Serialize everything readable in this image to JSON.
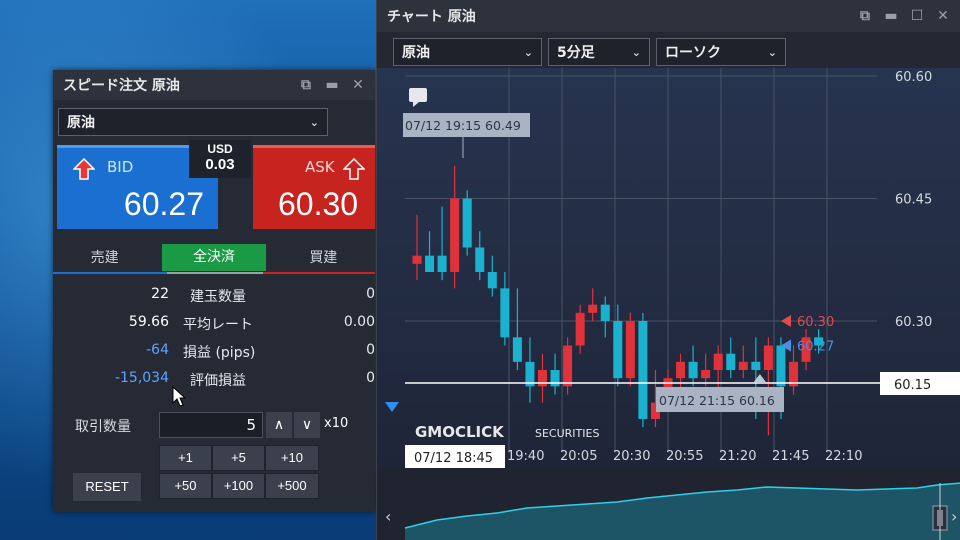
{
  "order_window": {
    "title": "スピード注文 原油",
    "symbol_select": "原油",
    "bid": {
      "label": "BID",
      "price": "60.27"
    },
    "ask": {
      "label": "ASK",
      "price": "60.30"
    },
    "spread": {
      "currency": "USD",
      "value": "0.03"
    },
    "tabs": [
      "売建",
      "全決済",
      "買建"
    ],
    "positions": [
      {
        "value": "22",
        "key": "建玉数量",
        "right": "0"
      },
      {
        "value": "59.66",
        "key": "平均レート",
        "right": "0.00"
      },
      {
        "value": "-64",
        "key": "損益 (pips)",
        "right": "0"
      },
      {
        "value": "-15,034",
        "key": "評価損益",
        "right": "0"
      }
    ],
    "lot": {
      "label": "取引数量",
      "value": "5",
      "multiplier": "x10"
    },
    "quick_buttons": [
      "+1",
      "+5",
      "+10",
      "+50",
      "+100",
      "+500"
    ],
    "reset_label": "RESET"
  },
  "chart_window": {
    "title": "チャート 原油",
    "symbol_select": "原油",
    "timeframe_select": "5分足",
    "type_select": "ローソク",
    "price_labels": [
      "60.60",
      "60.45",
      "60.30",
      "60.15"
    ],
    "time_labels": [
      "19:40",
      "20:05",
      "20:30",
      "20:55",
      "21:20",
      "21:45",
      "22:10"
    ],
    "high_marker": "07/12 19:15 60.49",
    "low_marker": "07/12 21:15 60.16",
    "cursor_price": "60.15",
    "cursor_time": "07/12 18:45",
    "ask_line": "60.30",
    "bid_line": "60.27",
    "watermark_brand": "GMOCLICK",
    "watermark_sub": "SECURITIES",
    "colors": {
      "up": "#e0323a",
      "down": "#1ab2cf",
      "ask": "#e34a4a",
      "bid": "#4a8fe0"
    }
  },
  "chart_data": {
    "type": "candlestick",
    "ylim": [
      60.12,
      60.6
    ],
    "candles": [
      {
        "o": 60.37,
        "h": 60.43,
        "l": 60.35,
        "c": 60.38
      },
      {
        "o": 60.38,
        "h": 60.41,
        "l": 60.36,
        "c": 60.36
      },
      {
        "o": 60.38,
        "h": 60.44,
        "l": 60.35,
        "c": 60.36
      },
      {
        "o": 60.36,
        "h": 60.49,
        "l": 60.34,
        "c": 60.45
      },
      {
        "o": 60.45,
        "h": 60.46,
        "l": 60.38,
        "c": 60.39
      },
      {
        "o": 60.39,
        "h": 60.41,
        "l": 60.35,
        "c": 60.36
      },
      {
        "o": 60.36,
        "h": 60.38,
        "l": 60.33,
        "c": 60.34
      },
      {
        "o": 60.34,
        "h": 60.36,
        "l": 60.27,
        "c": 60.28
      },
      {
        "o": 60.28,
        "h": 60.34,
        "l": 60.24,
        "c": 60.25
      },
      {
        "o": 60.25,
        "h": 60.28,
        "l": 60.2,
        "c": 60.22
      },
      {
        "o": 60.22,
        "h": 60.26,
        "l": 60.2,
        "c": 60.24
      },
      {
        "o": 60.24,
        "h": 60.26,
        "l": 60.21,
        "c": 60.22
      },
      {
        "o": 60.22,
        "h": 60.28,
        "l": 60.21,
        "c": 60.27
      },
      {
        "o": 60.27,
        "h": 60.32,
        "l": 60.26,
        "c": 60.31
      },
      {
        "o": 60.31,
        "h": 60.34,
        "l": 60.3,
        "c": 60.32
      },
      {
        "o": 60.32,
        "h": 60.33,
        "l": 60.28,
        "c": 60.3
      },
      {
        "o": 60.3,
        "h": 60.32,
        "l": 60.22,
        "c": 60.23
      },
      {
        "o": 60.23,
        "h": 60.31,
        "l": 60.22,
        "c": 60.3
      },
      {
        "o": 60.3,
        "h": 60.31,
        "l": 60.17,
        "c": 60.18
      },
      {
        "o": 60.18,
        "h": 60.24,
        "l": 60.17,
        "c": 60.2
      },
      {
        "o": 60.2,
        "h": 60.24,
        "l": 60.19,
        "c": 60.23
      },
      {
        "o": 60.23,
        "h": 60.26,
        "l": 60.21,
        "c": 60.25
      },
      {
        "o": 60.25,
        "h": 60.27,
        "l": 60.22,
        "c": 60.23
      },
      {
        "o": 60.23,
        "h": 60.26,
        "l": 60.22,
        "c": 60.24
      },
      {
        "o": 60.24,
        "h": 60.27,
        "l": 60.19,
        "c": 60.26
      },
      {
        "o": 60.26,
        "h": 60.28,
        "l": 60.23,
        "c": 60.24
      },
      {
        "o": 60.24,
        "h": 60.27,
        "l": 60.23,
        "c": 60.25
      },
      {
        "o": 60.25,
        "h": 60.28,
        "l": 60.18,
        "c": 60.24
      },
      {
        "o": 60.24,
        "h": 60.28,
        "l": 60.16,
        "c": 60.27
      },
      {
        "o": 60.27,
        "h": 60.28,
        "l": 60.18,
        "c": 60.22
      },
      {
        "o": 60.22,
        "h": 60.27,
        "l": 60.21,
        "c": 60.25
      },
      {
        "o": 60.25,
        "h": 60.29,
        "l": 60.24,
        "c": 60.28
      },
      {
        "o": 60.28,
        "h": 60.29,
        "l": 60.26,
        "c": 60.27
      }
    ]
  }
}
